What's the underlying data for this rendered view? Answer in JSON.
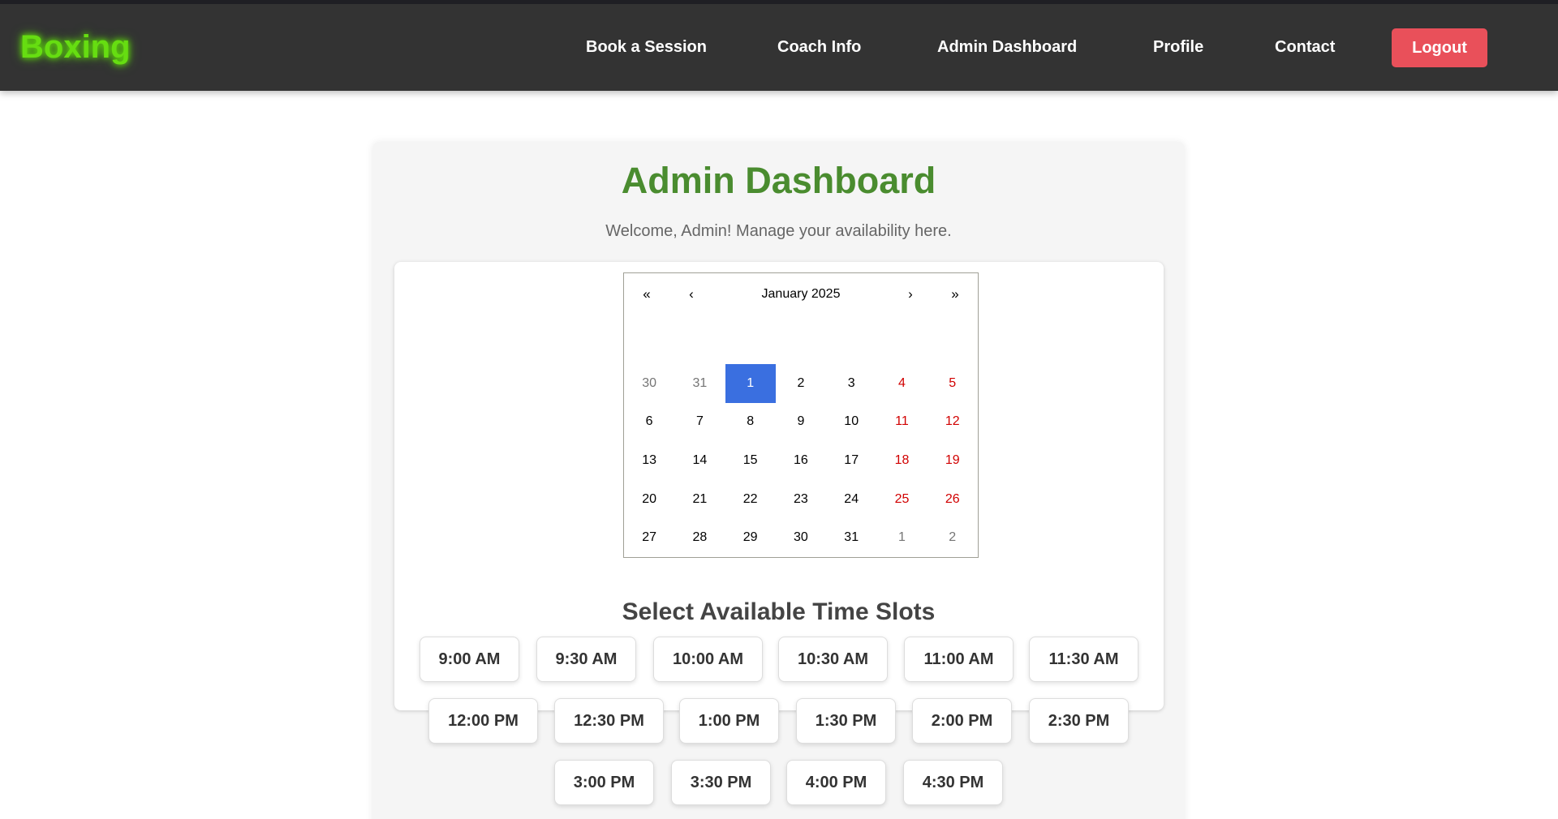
{
  "nav": {
    "brand": "Boxing",
    "links": [
      "Book a Session",
      "Coach Info",
      "Admin Dashboard",
      "Profile",
      "Contact"
    ],
    "logout": "Logout"
  },
  "colors": {
    "navbar": "#333333",
    "brand": "#66dd11",
    "logout": "#e9505a",
    "title": "#4a8c2f",
    "selected_day": "#3a6fe0",
    "weekend_day": "#d10000"
  },
  "main": {
    "title": "Admin Dashboard",
    "welcome": "Welcome, Admin! Manage your availability here."
  },
  "calendar": {
    "prev_year": "«",
    "prev_month": "‹",
    "month_label": "January 2025",
    "next_month": "›",
    "next_year": "»",
    "selected_day": "1",
    "weeks": [
      [
        {
          "d": "30",
          "t": "other"
        },
        {
          "d": "31",
          "t": "other"
        },
        {
          "d": "1",
          "t": "selected"
        },
        {
          "d": "2",
          "t": ""
        },
        {
          "d": "3",
          "t": ""
        },
        {
          "d": "4",
          "t": "weekend"
        },
        {
          "d": "5",
          "t": "weekend"
        }
      ],
      [
        {
          "d": "6",
          "t": ""
        },
        {
          "d": "7",
          "t": ""
        },
        {
          "d": "8",
          "t": ""
        },
        {
          "d": "9",
          "t": ""
        },
        {
          "d": "10",
          "t": ""
        },
        {
          "d": "11",
          "t": "weekend"
        },
        {
          "d": "12",
          "t": "weekend"
        }
      ],
      [
        {
          "d": "13",
          "t": ""
        },
        {
          "d": "14",
          "t": ""
        },
        {
          "d": "15",
          "t": ""
        },
        {
          "d": "16",
          "t": ""
        },
        {
          "d": "17",
          "t": ""
        },
        {
          "d": "18",
          "t": "weekend"
        },
        {
          "d": "19",
          "t": "weekend"
        }
      ],
      [
        {
          "d": "20",
          "t": ""
        },
        {
          "d": "21",
          "t": ""
        },
        {
          "d": "22",
          "t": ""
        },
        {
          "d": "23",
          "t": ""
        },
        {
          "d": "24",
          "t": ""
        },
        {
          "d": "25",
          "t": "weekend"
        },
        {
          "d": "26",
          "t": "weekend"
        }
      ],
      [
        {
          "d": "27",
          "t": ""
        },
        {
          "d": "28",
          "t": ""
        },
        {
          "d": "29",
          "t": ""
        },
        {
          "d": "30",
          "t": ""
        },
        {
          "d": "31",
          "t": ""
        },
        {
          "d": "1",
          "t": "other"
        },
        {
          "d": "2",
          "t": "other"
        }
      ]
    ]
  },
  "slots": {
    "title": "Select Available Time Slots",
    "times": [
      "9:00 AM",
      "9:30 AM",
      "10:00 AM",
      "10:30 AM",
      "11:00 AM",
      "11:30 AM",
      "12:00 PM",
      "12:30 PM",
      "1:00 PM",
      "1:30 PM",
      "2:00 PM",
      "2:30 PM",
      "3:00 PM",
      "3:30 PM",
      "4:00 PM",
      "4:30 PM"
    ]
  }
}
